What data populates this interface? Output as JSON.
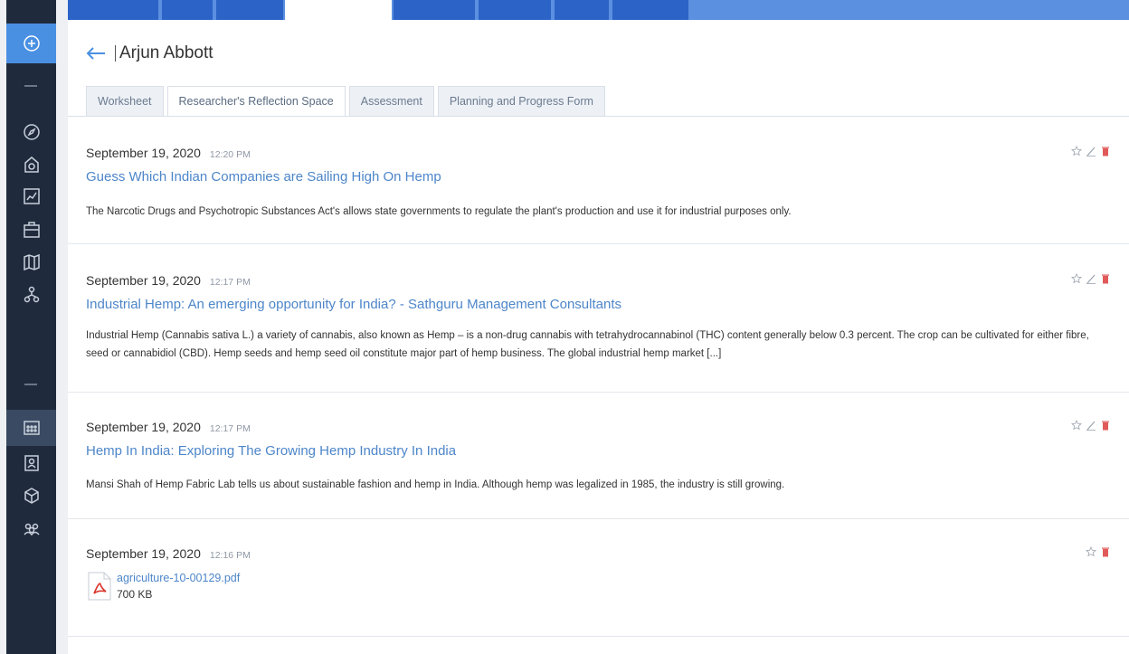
{
  "header": {
    "title": "Arjun Abbott"
  },
  "tabs": [
    {
      "label": "Worksheet"
    },
    {
      "label": "Researcher's Reflection Space"
    },
    {
      "label": "Assessment"
    },
    {
      "label": "Planning and Progress Form"
    }
  ],
  "entries": [
    {
      "date": "September 19, 2020",
      "time": "12:20 PM",
      "title": "Guess Which Indian Companies are Sailing High On Hemp",
      "description": "The Narcotic Drugs and Psychotropic Substances Act's allows state governments to regulate the plant's production and use it for industrial purposes only."
    },
    {
      "date": "September 19, 2020",
      "time": "12:17 PM",
      "title": "Industrial Hemp: An emerging opportunity for India? - Sathguru Management Consultants",
      "description": "Industrial Hemp (Cannabis sativa L.) a variety of cannabis, also known as Hemp – is a non-drug cannabis with tetrahydrocannabinol (THC) content generally below 0.3 percent. The crop can be cultivated for either fibre, seed or cannabidiol (CBD). Hemp seeds and hemp seed oil constitute major part of hemp business. The global industrial hemp market [...]"
    },
    {
      "date": "September 19, 2020",
      "time": "12:17 PM",
      "title": "Hemp In India: Exploring The Growing Hemp Industry In India",
      "description": "Mansi Shah of Hemp Fabric Lab tells us about sustainable fashion and hemp in India. Although hemp was legalized in 1985, the industry is still growing."
    },
    {
      "date": "September 19, 2020",
      "time": "12:16 PM",
      "file_name": "agriculture-10-00129.pdf",
      "file_size": "700 KB"
    }
  ],
  "colors": {
    "accent": "#4a90e2",
    "link": "#4d86c9",
    "sidebar": "#1f2b3d",
    "delete": "#e05a5a"
  }
}
